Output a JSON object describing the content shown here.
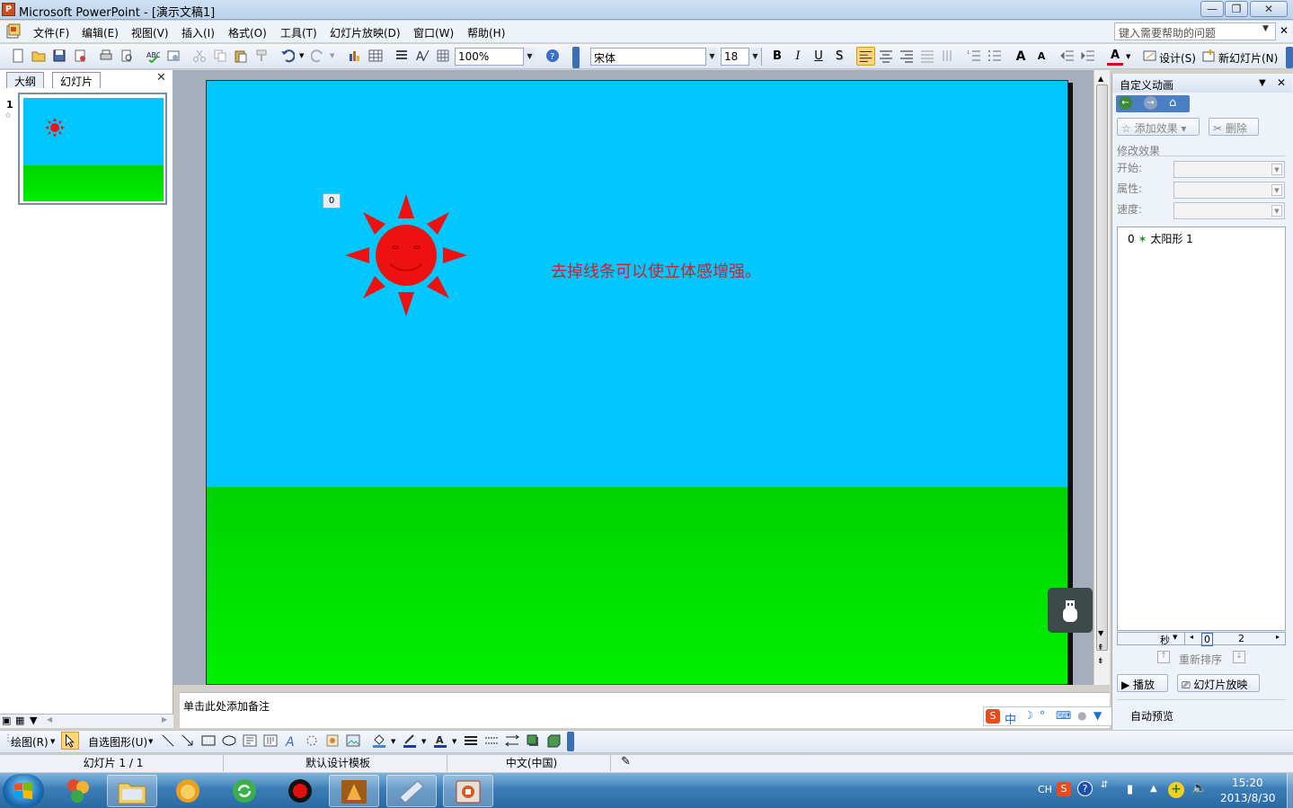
{
  "window": {
    "title": "Microsoft PowerPoint - [演示文稿1]",
    "minimize_glyph": "—",
    "maximize_glyph": "❐",
    "close_glyph": "✕"
  },
  "menu": {
    "items": [
      "文件(F)",
      "编辑(E)",
      "视图(V)",
      "插入(I)",
      "格式(O)",
      "工具(T)",
      "幻灯片放映(D)",
      "窗口(W)",
      "帮助(H)"
    ],
    "help_placeholder": "键入需要帮助的问题"
  },
  "toolbar": {
    "zoom": "100%",
    "font_name": "宋体",
    "font_size": "18",
    "bold": "B",
    "italic": "I",
    "underline": "U",
    "shadow": "S",
    "design_label": "设计(S)",
    "new_slide_label": "新幻灯片(N)",
    "font_grow": "A",
    "font_color": "A"
  },
  "left_panel": {
    "tabs": [
      "大纲",
      "幻灯片"
    ],
    "close_glyph": "✕",
    "slide_number": "1",
    "slide_star": "☆"
  },
  "slide": {
    "anim_tag": "0",
    "text": "去掉线条可以使立体感增强。",
    "sky_color": "#00c8ff",
    "grass_color": "#00e000",
    "sun_color": "#ee1111"
  },
  "notes": {
    "placeholder": "单击此处添加备注"
  },
  "task_pane": {
    "title": "自定义动画",
    "add_effect": "添加效果",
    "delete": "删除",
    "modify_label": "修改效果",
    "start_label": "开始:",
    "property_label": "属性:",
    "speed_label": "速度:",
    "effect_item": {
      "index": "0",
      "name": "太阳形 1"
    },
    "timeline_unit": "秒",
    "timeline_ticks": [
      "0",
      "2"
    ],
    "reorder_label": "重新排序",
    "play_label": "播放",
    "slideshow_label": "幻灯片放映",
    "auto_preview_label": "自动预览"
  },
  "draw_toolbar": {
    "draw_label": "绘图(R)",
    "autoshape_label": "自选图形(U)"
  },
  "status": {
    "slide_info": "幻灯片 1 / 1",
    "template": "默认设计模板",
    "language": "中文(中国)"
  },
  "taskbar": {
    "lang": "CH",
    "time": "15:20",
    "date": "2013/8/30"
  }
}
